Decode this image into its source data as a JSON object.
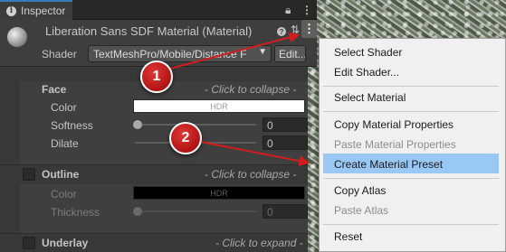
{
  "tab": {
    "label": "Inspector",
    "info_icon": "info-icon",
    "lock_icon": "lock-icon",
    "menu_icon": "kebab-menu-icon"
  },
  "header": {
    "title": "Liberation Sans SDF Material (Material)",
    "shader_label": "Shader",
    "shader_value": "TextMeshPro/Mobile/Distance F",
    "edit_label": "Edit..."
  },
  "sections": {
    "face": {
      "title": "Face",
      "hint": "- Click to collapse -",
      "color_label": "Color",
      "color_value": "HDR",
      "softness_label": "Softness",
      "softness_value": "0",
      "dilate_label": "Dilate",
      "dilate_value": "0"
    },
    "outline": {
      "title": "Outline",
      "hint": "- Click to collapse -",
      "color_label": "Color",
      "color_value": "HDR",
      "thickness_label": "Thickness",
      "thickness_value": "0"
    },
    "underlay": {
      "title": "Underlay",
      "hint": "- Click to expand -"
    }
  },
  "menu": {
    "items": [
      {
        "label": "Select Shader",
        "enabled": true
      },
      {
        "label": "Edit Shader...",
        "enabled": true
      },
      {
        "label": "Select Material",
        "enabled": true
      },
      {
        "label": "Copy Material Properties",
        "enabled": true
      },
      {
        "label": "Paste Material Properties",
        "enabled": false
      },
      {
        "label": "Create Material Preset",
        "enabled": true,
        "highlighted": true
      },
      {
        "label": "Copy Atlas",
        "enabled": true
      },
      {
        "label": "Paste Atlas",
        "enabled": false
      },
      {
        "label": "Reset",
        "enabled": true
      }
    ]
  },
  "callouts": {
    "first": "1",
    "second": "2"
  },
  "colors": {
    "accent": "#3a79bb",
    "highlight": "#99c8f5",
    "callout": "#c41c1c"
  }
}
